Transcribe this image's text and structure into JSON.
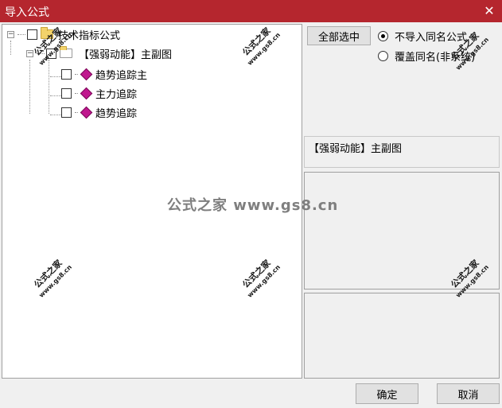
{
  "window": {
    "title": "导入公式",
    "close_glyph": "✕"
  },
  "tree": {
    "root": {
      "label": "技术指标公式",
      "expander": "−"
    },
    "group": {
      "label": "【强弱动能】主副图",
      "expander": "−"
    },
    "items": [
      {
        "label": "趋势追踪主"
      },
      {
        "label": "主力追踪"
      },
      {
        "label": "趋势追踪"
      }
    ]
  },
  "options": {
    "select_all_label": "全部选中",
    "radio_no_import_label": "不导入同名公式",
    "radio_overwrite_label": "覆盖同名(非系统)",
    "selected_option": "不导入同名公式"
  },
  "info": {
    "selected_name": "【强弱动能】主副图"
  },
  "footer": {
    "ok_label": "确定",
    "cancel_label": "取消"
  },
  "watermark": {
    "text": "公式之家",
    "url": "www.gs8.cn",
    "center_text": "公式之家 www.gs8.cn"
  }
}
